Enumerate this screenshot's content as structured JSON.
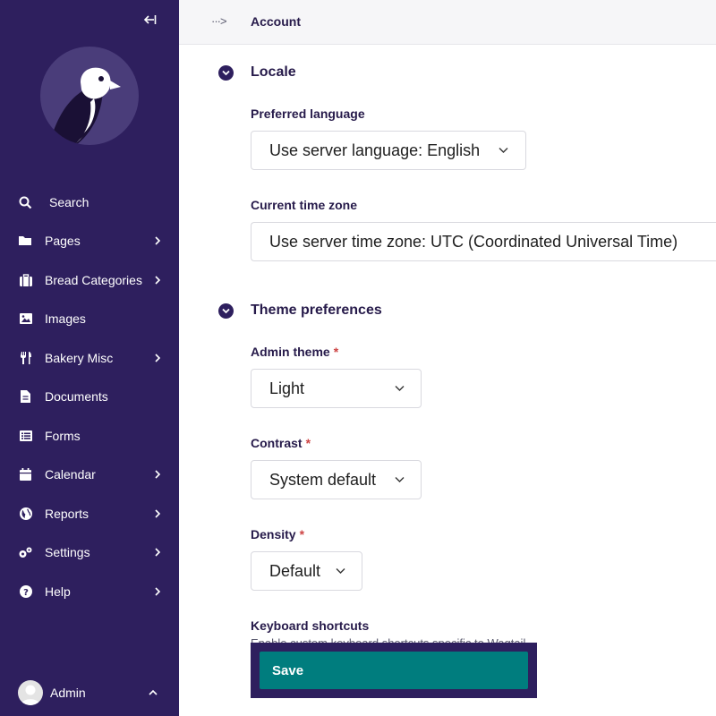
{
  "header": {
    "breadcrumb_toggle": "···>",
    "current_page": "Account"
  },
  "sidebar": {
    "collapse_icon": "collapse-left-icon",
    "items": [
      {
        "label": "Search",
        "icon": "search-icon",
        "has_submenu": false
      },
      {
        "label": "Pages",
        "icon": "folder-icon",
        "has_submenu": true
      },
      {
        "label": "Bread Categories",
        "icon": "suitcase-icon",
        "has_submenu": true
      },
      {
        "label": "Images",
        "icon": "image-icon",
        "has_submenu": false
      },
      {
        "label": "Bakery Misc",
        "icon": "utensils-icon",
        "has_submenu": true
      },
      {
        "label": "Documents",
        "icon": "document-icon",
        "has_submenu": false
      },
      {
        "label": "Forms",
        "icon": "list-icon",
        "has_submenu": false
      },
      {
        "label": "Calendar",
        "icon": "calendar-icon",
        "has_submenu": true
      },
      {
        "label": "Reports",
        "icon": "globe-icon",
        "has_submenu": true
      },
      {
        "label": "Settings",
        "icon": "cogs-icon",
        "has_submenu": true
      },
      {
        "label": "Help",
        "icon": "help-icon",
        "has_submenu": true
      }
    ],
    "account": {
      "label": "Admin"
    }
  },
  "sections": {
    "locale": {
      "title": "Locale",
      "preferred_language": {
        "label": "Preferred language",
        "value": "Use server language: English"
      },
      "time_zone": {
        "label": "Current time zone",
        "value": "Use server time zone: UTC (Coordinated Universal Time)"
      }
    },
    "theme": {
      "title": "Theme preferences",
      "admin_theme": {
        "label": "Admin theme",
        "required": "*",
        "value": "Light"
      },
      "contrast": {
        "label": "Contrast",
        "required": "*",
        "value": "System default"
      },
      "density": {
        "label": "Density",
        "required": "*",
        "value": "Default"
      },
      "keyboard_shortcuts": {
        "label": "Keyboard shortcuts",
        "help": "Enable custom keyboard shortcuts specific to Wagtail."
      }
    }
  },
  "footer": {
    "save_label": "Save"
  },
  "colors": {
    "sidebar_bg": "#2e1f5e",
    "primary_text": "#261a4a",
    "save_button": "#007d7e",
    "required": "#cd4444"
  }
}
